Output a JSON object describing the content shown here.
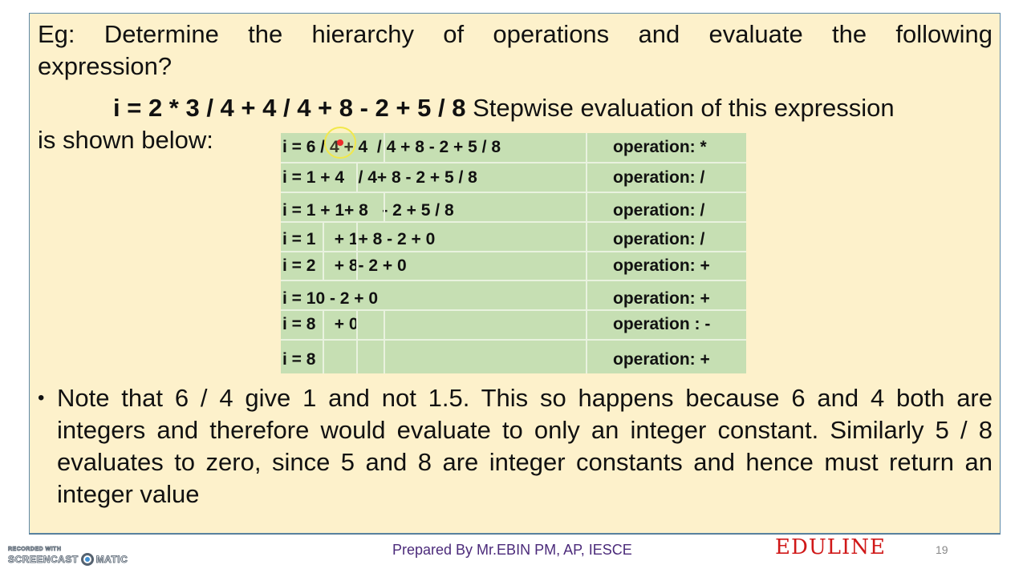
{
  "slide": {
    "heading_words": [
      "Eg:",
      "Determine",
      "the",
      "hierarchy",
      "of",
      "operations",
      "and",
      "evaluate",
      "the",
      "following"
    ],
    "heading_line2": "expression?",
    "expression": "i = 2 * 3 / 4 + 4 / 4 + 8 - 2 + 5 / 8",
    "expression_suffix": "Stepwise evaluation of this expression",
    "shown_below": "is shown below:",
    "steps": [
      {
        "expr": "i = 6 / 4 + 4  / 4 + 8 - 2 + 5 / 8",
        "op": "operation: *"
      },
      {
        "expr": "i = 1 + 4   / 4+ 8 - 2 + 5 / 8",
        "op": "operation: /"
      },
      {
        "expr": "i = 1 + 1+ 8   - 2 + 5 / 8",
        "op": "operation: /"
      },
      {
        "expr": "i = 1    + 1+ 8 - 2 + 0",
        "op": "operation: /"
      },
      {
        "expr": "i = 2    + 8- 2 + 0",
        "op": "operation: +"
      },
      {
        "expr": "i = 10 - 2 + 0",
        "op": "operation: +"
      },
      {
        "expr": "i = 8    + 0",
        "op": "operation : -"
      },
      {
        "expr": "i = 8",
        "op": "operation: +"
      }
    ],
    "note_bullet": "•",
    "note": "Note that 6 / 4 give 1 and not 1.5. This so happens because 6 and 4 both are integers and therefore would evaluate to only an integer constant. Similarly 5 / 8 evaluates to zero, since 5 and 8 are integer constants and hence must return an integer value"
  },
  "footer": {
    "author": "Prepared By Mr.EBIN PM, AP, IESCE",
    "brand": "EDULINE",
    "page_number": "19"
  },
  "watermark": {
    "top": "RECORDED WITH",
    "left": "SCREENCAST",
    "right": "MATIC"
  },
  "colors": {
    "slide_fill": "#fdf1cb",
    "table_fill": "#c6dfb3",
    "border": "#5f8aa8",
    "brand_red": "#d01818",
    "author_purple": "#4b2a7a"
  }
}
